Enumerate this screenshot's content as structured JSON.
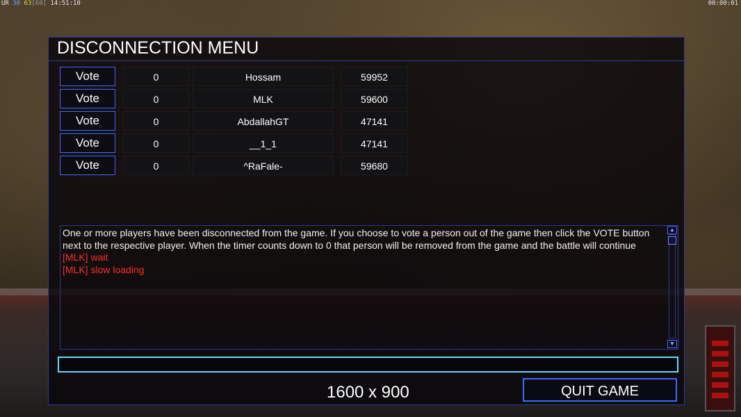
{
  "hud": {
    "left_label": "UR",
    "left_a": "30",
    "left_b": "63",
    "left_c": "[60]",
    "clock": "14:51:10",
    "timer": "00:00:01"
  },
  "dialog": {
    "title": "DISCONNECTION MENU",
    "vote_label": "Vote",
    "players": [
      {
        "votes": "0",
        "name": "Hossam",
        "ping": "59952"
      },
      {
        "votes": "0",
        "name": "MLK",
        "ping": "59600"
      },
      {
        "votes": "0",
        "name": "AbdallahGT",
        "ping": "47141"
      },
      {
        "votes": "0",
        "name": "__1_1",
        "ping": "47141"
      },
      {
        "votes": "0",
        "name": "^RaFale-",
        "ping": "59680"
      }
    ],
    "chat": {
      "system_message": "One or more players have been disconnected from the game. If you choose to vote a person out of the game then click the VOTE button next to the respective player. When the timer counts down to 0 that person will be removed from the game and the battle will continue",
      "messages": [
        "[MLK] wait",
        "[MLK] slow loading"
      ]
    },
    "input_value": "",
    "resolution_text": "1600 x 900",
    "quit_label": "QUIT GAME"
  },
  "colors": {
    "accent_border": "#3a6cff",
    "chat_message": "#ff2a2a",
    "input_border": "#6fd6ff"
  }
}
